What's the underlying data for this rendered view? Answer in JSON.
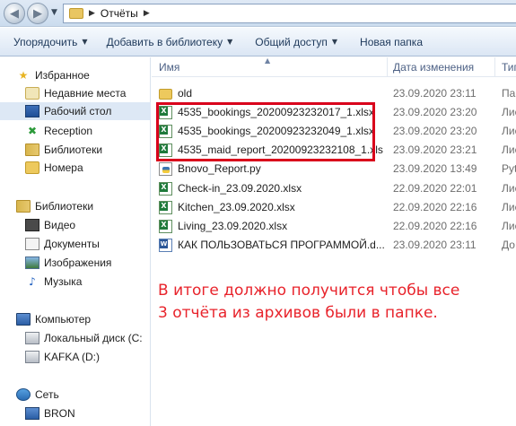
{
  "address_bar": {
    "path": [
      "Отчёты"
    ]
  },
  "toolbar": {
    "items": [
      {
        "label": "Упорядочить",
        "has_dropdown": true
      },
      {
        "label": "Добавить в библиотеку",
        "has_dropdown": true
      },
      {
        "label": "Общий доступ",
        "has_dropdown": true
      },
      {
        "label": "Новая папка",
        "has_dropdown": false
      }
    ]
  },
  "sidebar": {
    "favorites": {
      "label": "Избранное",
      "icon": "star-icon",
      "items": [
        {
          "label": "Недавние места",
          "icon": "recent-places-icon"
        },
        {
          "label": "Рабочий стол",
          "icon": "desktop-icon",
          "selected": true
        },
        {
          "label": "Reception",
          "icon": "reception-shortcut-icon"
        },
        {
          "label": "Библиотеки",
          "icon": "libraries-icon"
        },
        {
          "label": "Номера",
          "icon": "folder-icon"
        }
      ]
    },
    "libraries": {
      "label": "Библиотеки",
      "icon": "libraries-icon",
      "items": [
        {
          "label": "Видео",
          "icon": "video-icon"
        },
        {
          "label": "Документы",
          "icon": "documents-icon"
        },
        {
          "label": "Изображения",
          "icon": "pictures-icon"
        },
        {
          "label": "Музыка",
          "icon": "music-icon"
        }
      ]
    },
    "computer": {
      "label": "Компьютер",
      "icon": "computer-icon",
      "items": [
        {
          "label": "Локальный диск (C:",
          "icon": "drive-icon"
        },
        {
          "label": "KAFKA (D:)",
          "icon": "drive-icon"
        }
      ]
    },
    "network": {
      "label": "Сеть",
      "icon": "network-icon",
      "items": [
        {
          "label": "BRON",
          "icon": "network-computer-icon"
        }
      ]
    }
  },
  "file_list": {
    "columns": {
      "name": "Имя",
      "date": "Дата изменения",
      "type": "Тип"
    },
    "files": [
      {
        "name": "old",
        "date": "23.09.2020 23:11",
        "type": "Па",
        "icon": "folder-icon"
      },
      {
        "name": "4535_bookings_20200923232017_1.xlsx",
        "date": "23.09.2020 23:20",
        "type": "Лис",
        "icon": "excel-file-icon"
      },
      {
        "name": "4535_bookings_20200923232049_1.xlsx",
        "date": "23.09.2020 23:20",
        "type": "Лис",
        "icon": "excel-file-icon"
      },
      {
        "name": "4535_maid_report_20200923232108_1.xls",
        "date": "23.09.2020 23:21",
        "type": "Лис",
        "icon": "excel-file-icon"
      },
      {
        "name": "Bnovo_Report.py",
        "date": "23.09.2020 13:49",
        "type": "Pyt",
        "icon": "python-file-icon"
      },
      {
        "name": "Check-in_23.09.2020.xlsx",
        "date": "22.09.2020 22:01",
        "type": "Лис",
        "icon": "excel-file-icon"
      },
      {
        "name": "Kitchen_23.09.2020.xlsx",
        "date": "22.09.2020 22:16",
        "type": "Лис",
        "icon": "excel-file-icon"
      },
      {
        "name": "Living_23.09.2020.xlsx",
        "date": "22.09.2020 22:16",
        "type": "Лис",
        "icon": "excel-file-icon"
      },
      {
        "name": "КАК ПОЛЬЗОВАТЬСЯ ПРОГРАММОЙ.d...",
        "date": "23.09.2020 23:11",
        "type": "До",
        "icon": "word-file-icon"
      }
    ]
  },
  "annotation": {
    "lines": [
      "В итоге должно получится чтобы все",
      "3 отчёта из архивов были в папке."
    ],
    "color": "#e8232b"
  },
  "highlight": {
    "color": "#d9001b",
    "files_highlighted": 3
  }
}
